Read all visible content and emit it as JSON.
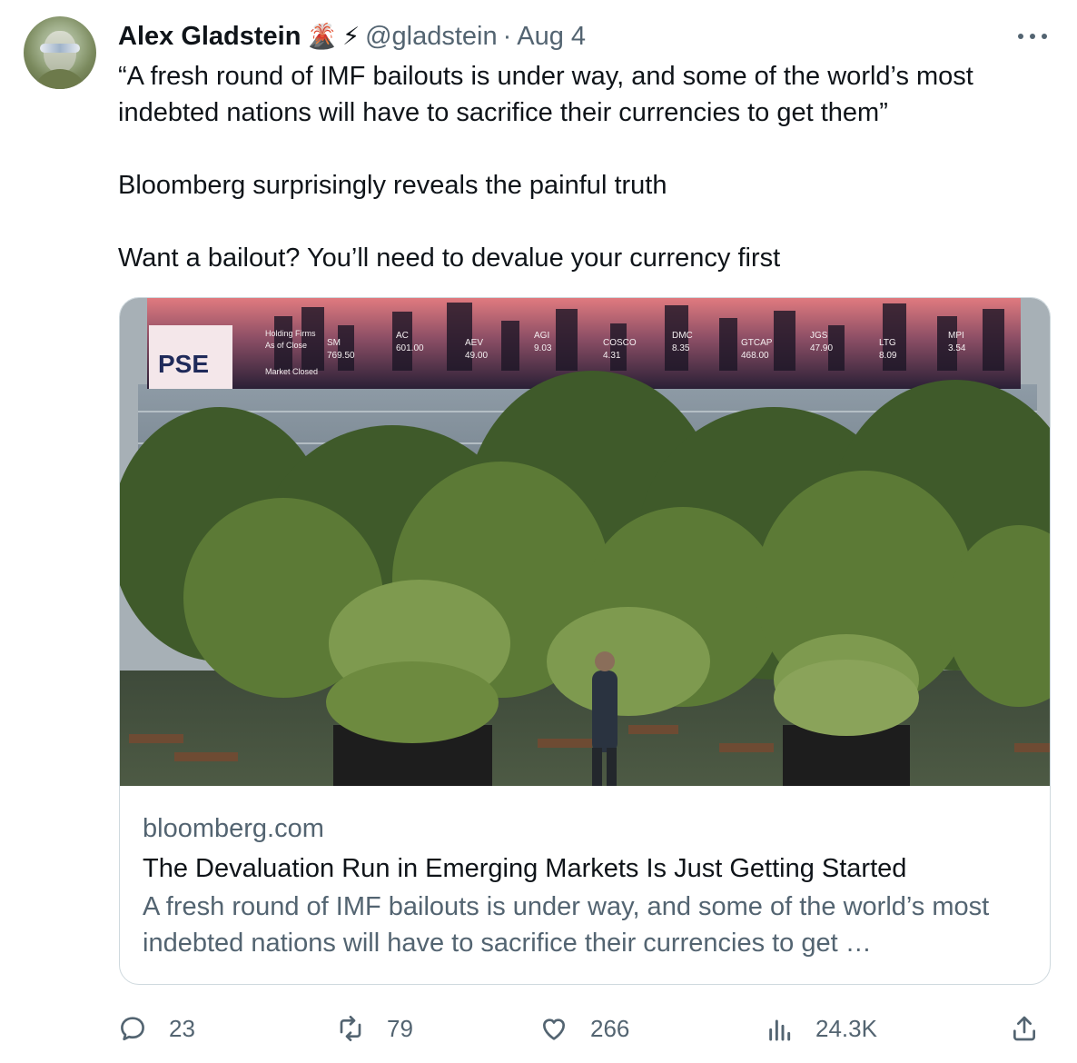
{
  "author": {
    "name": "Alex Gladstein",
    "emoji_1": "🌋",
    "emoji_2": "⚡",
    "handle": "@gladstein",
    "separator": "·",
    "date": "Aug 4"
  },
  "tweet": {
    "paragraph_1": "“A fresh round of IMF bailouts is under way, and some of the world’s most indebted nations will have to sacrifice their currencies to get them”",
    "paragraph_2": "Bloomberg surprisingly reveals the painful truth",
    "paragraph_3": "Want a bailout? You’ll need to devalue your currency first"
  },
  "card": {
    "domain": "bloomberg.com",
    "title": "The Devaluation Run in Emerging Markets Is Just Getting Started",
    "description": "A fresh round of IMF bailouts is under way, and some of the world’s most indebted nations will have to sacrifice their currencies to get …",
    "image": {
      "logo": "PSE",
      "board_header_1": "Holding Firms",
      "board_header_2": "As of Close",
      "board_status": "Market Closed",
      "tickers": [
        {
          "sym": "SM",
          "price": "769.50"
        },
        {
          "sym": "AC",
          "price": "601.00"
        },
        {
          "sym": "AEV",
          "price": "49.00"
        },
        {
          "sym": "AGI",
          "price": "9.03"
        },
        {
          "sym": "COSCO",
          "price": "4.31"
        },
        {
          "sym": "DMC",
          "price": "8.35"
        },
        {
          "sym": "GTCAP",
          "price": "468.00"
        },
        {
          "sym": "JGS",
          "price": "47.90"
        },
        {
          "sym": "LTG",
          "price": "8.09"
        },
        {
          "sym": "MPI",
          "price": "3.54"
        }
      ]
    }
  },
  "actions": {
    "replies": "23",
    "reposts": "79",
    "likes": "266",
    "views": "24.3K"
  },
  "icons": {
    "reply": "reply-icon",
    "repost": "repost-icon",
    "like": "like-icon",
    "views": "views-icon",
    "share": "share-icon",
    "more": "more-icon"
  },
  "colors": {
    "text": "#0f1419",
    "secondary": "#536471",
    "border": "#cfd9de"
  }
}
